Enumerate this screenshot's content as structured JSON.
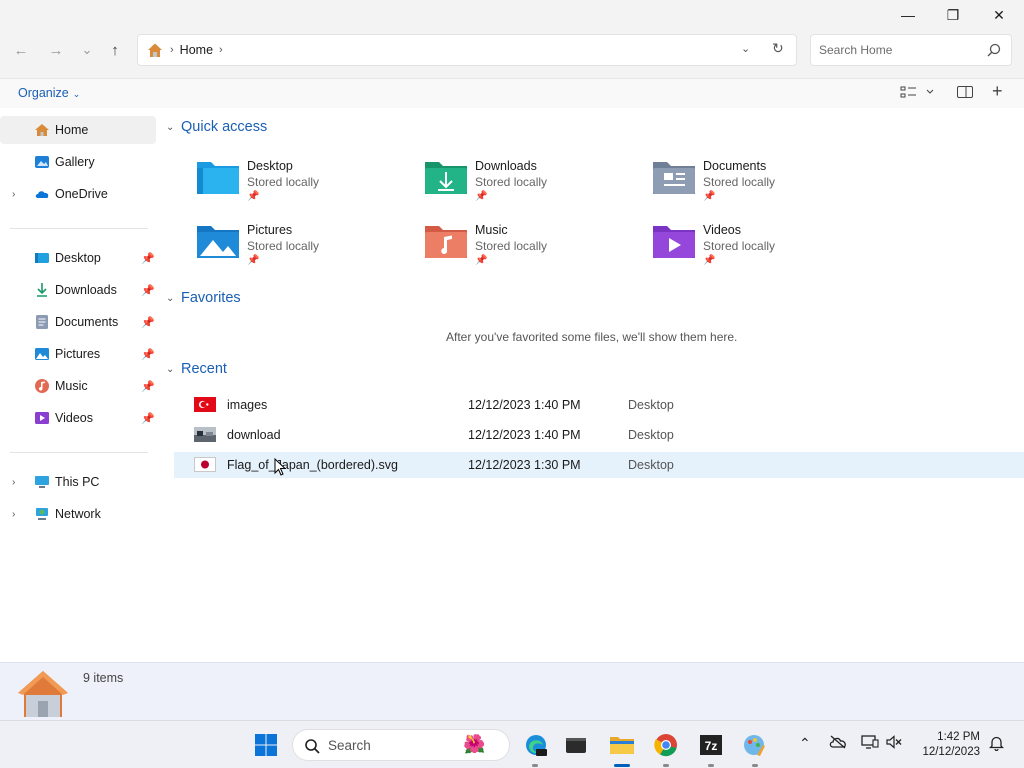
{
  "window": {
    "controls": {
      "minimize": "—",
      "maximize": "❐",
      "close": "✕"
    }
  },
  "nav": {
    "back": "←",
    "forward": "→",
    "recent": "⌄",
    "up": "↑",
    "breadcrumb": [
      "Home"
    ],
    "refresh": "↻",
    "search_placeholder": "Search Home"
  },
  "command_bar": {
    "organize_label": "Organize"
  },
  "sidebar": {
    "top": [
      {
        "label": "Home",
        "icon": "home-icon",
        "selected": true
      },
      {
        "label": "Gallery",
        "icon": "gallery-icon"
      },
      {
        "label": "OneDrive",
        "icon": "cloud-icon",
        "expandable": true
      }
    ],
    "pinned": [
      {
        "label": "Desktop",
        "icon": "desktop-icon"
      },
      {
        "label": "Downloads",
        "icon": "download-icon"
      },
      {
        "label": "Documents",
        "icon": "document-icon"
      },
      {
        "label": "Pictures",
        "icon": "pictures-icon"
      },
      {
        "label": "Music",
        "icon": "music-icon"
      },
      {
        "label": "Videos",
        "icon": "video-icon"
      }
    ],
    "bottom": [
      {
        "label": "This PC",
        "icon": "computer-icon",
        "expandable": true
      },
      {
        "label": "Network",
        "icon": "network-icon",
        "expandable": true
      }
    ]
  },
  "main": {
    "quick_access": {
      "title": "Quick access",
      "items": [
        {
          "name": "Desktop",
          "status": "Stored locally",
          "icon": "desktop-folder-icon"
        },
        {
          "name": "Downloads",
          "status": "Stored locally",
          "icon": "downloads-folder-icon"
        },
        {
          "name": "Documents",
          "status": "Stored locally",
          "icon": "documents-folder-icon"
        },
        {
          "name": "Pictures",
          "status": "Stored locally",
          "icon": "pictures-folder-icon"
        },
        {
          "name": "Music",
          "status": "Stored locally",
          "icon": "music-folder-icon"
        },
        {
          "name": "Videos",
          "status": "Stored locally",
          "icon": "videos-folder-icon"
        }
      ]
    },
    "favorites": {
      "title": "Favorites",
      "empty_message": "After you've favorited some files, we'll show them here."
    },
    "recent": {
      "title": "Recent",
      "rows": [
        {
          "name": "images",
          "date": "12/12/2023 1:40 PM",
          "location": "Desktop",
          "icon": "turkey-flag-thumbnail"
        },
        {
          "name": "download",
          "date": "12/12/2023 1:40 PM",
          "location": "Desktop",
          "icon": "photo-thumbnail"
        },
        {
          "name": "Flag_of_Japan_(bordered).svg",
          "date": "12/12/2023 1:30 PM",
          "location": "Desktop",
          "icon": "japan-flag-thumbnail",
          "hovered": true
        }
      ]
    }
  },
  "details": {
    "item_count": "9 items"
  },
  "taskbar": {
    "search_label": "Search",
    "clock_time": "1:42 PM",
    "clock_date": "12/12/2023"
  },
  "colors": {
    "accent": "#005fb8",
    "link_blue": "#1a5fb4",
    "hover_row": "#e5f1fb"
  }
}
